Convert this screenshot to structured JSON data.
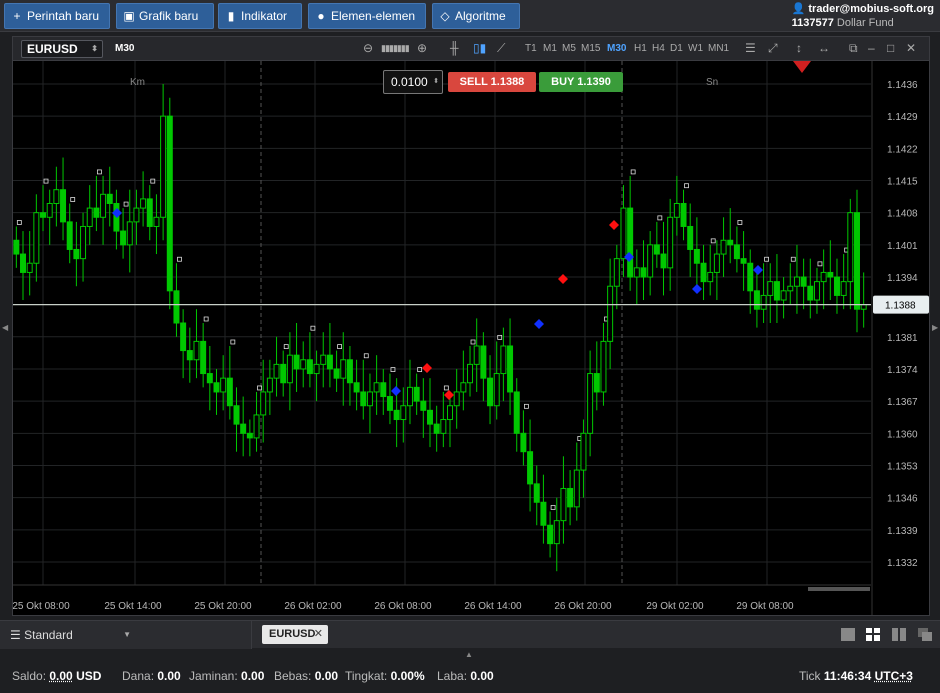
{
  "toolbar": {
    "buttons": [
      {
        "label": "Perintah baru",
        "icon": "plus-icon"
      },
      {
        "label": "Grafik baru",
        "icon": "chart-icon"
      },
      {
        "label": "Indikator",
        "icon": "bar-chart-icon"
      },
      {
        "label": "Elemen-elemen",
        "icon": "brush-icon"
      },
      {
        "label": "Algoritme",
        "icon": "diamond-icon"
      }
    ]
  },
  "account": {
    "user": "trader@mobius-soft.org",
    "number": "1137577",
    "fund": "Dollar Fund"
  },
  "chart": {
    "symbol": "EURUSD",
    "timeframe": "M30",
    "timeframes": [
      "T1",
      "M1",
      "M5",
      "M15",
      "M30",
      "H1",
      "H4",
      "D1",
      "W1",
      "MN1"
    ],
    "active_timeframe": "M30",
    "lot": "0.0100",
    "sell": {
      "label": "SELL",
      "price": "1.1388"
    },
    "buy": {
      "label": "BUY",
      "price": "1.1390"
    },
    "day_labels": [
      "Km",
      "Sn"
    ],
    "price_ticks": [
      "1.1436",
      "1.1429",
      "1.1422",
      "1.1415",
      "1.1408",
      "1.1401",
      "1.1394",
      "1.1381",
      "1.1374",
      "1.1367",
      "1.1360",
      "1.1353",
      "1.1346",
      "1.1339",
      "1.1332"
    ],
    "current_price": "1.1388",
    "time_ticks": [
      "25 Okt 08:00",
      "25 Okt 14:00",
      "25 Okt 20:00",
      "26 Okt 02:00",
      "26 Okt 08:00",
      "26 Okt 14:00",
      "26 Okt 20:00",
      "29 Okt 02:00",
      "29 Okt 08:00"
    ],
    "colors": {
      "up": "#00c800",
      "down": "#00a000",
      "bg": "#000000",
      "grid": "#222426",
      "price_line": "#c8d0c8"
    }
  },
  "chart_data": {
    "type": "candlestick",
    "title": "EURUSD M30",
    "y_axis_range": [
      1.1327,
      1.1441
    ],
    "current_price": 1.1388,
    "x_labels": [
      "25 Okt 08:00",
      "25 Okt 14:00",
      "25 Okt 20:00",
      "26 Okt 02:00",
      "26 Okt 08:00",
      "26 Okt 14:00",
      "26 Okt 20:00",
      "29 Okt 02:00",
      "29 Okt 08:00"
    ],
    "closes": [
      1.1399,
      1.1395,
      1.1397,
      1.1408,
      1.1407,
      1.141,
      1.1413,
      1.1406,
      1.14,
      1.1398,
      1.1405,
      1.1409,
      1.1407,
      1.1412,
      1.141,
      1.1404,
      1.1401,
      1.1406,
      1.1409,
      1.1411,
      1.1405,
      1.1407,
      1.1429,
      1.1391,
      1.1384,
      1.1378,
      1.1376,
      1.138,
      1.1373,
      1.1371,
      1.1369,
      1.1372,
      1.1366,
      1.1362,
      1.136,
      1.1359,
      1.1364,
      1.1369,
      1.1372,
      1.1375,
      1.1371,
      1.1377,
      1.1374,
      1.1376,
      1.1373,
      1.1375,
      1.1377,
      1.1374,
      1.1372,
      1.1376,
      1.1371,
      1.1369,
      1.1366,
      1.1369,
      1.1371,
      1.1368,
      1.1365,
      1.1363,
      1.1366,
      1.137,
      1.1367,
      1.1365,
      1.1362,
      1.136,
      1.1363,
      1.1366,
      1.1369,
      1.1371,
      1.1375,
      1.1379,
      1.1372,
      1.1366,
      1.1373,
      1.1379,
      1.1369,
      1.136,
      1.1356,
      1.1349,
      1.1345,
      1.134,
      1.1336,
      1.1341,
      1.1348,
      1.1344,
      1.1352,
      1.136,
      1.1373,
      1.1369,
      1.138,
      1.1392,
      1.1398,
      1.1409,
      1.1394,
      1.1396,
      1.1394,
      1.1401,
      1.1399,
      1.1396,
      1.1407,
      1.141,
      1.1405,
      1.14,
      1.1397,
      1.1393,
      1.1395,
      1.1399,
      1.1402,
      1.1401,
      1.1398,
      1.1397,
      1.1391,
      1.1387,
      1.139,
      1.1393,
      1.1389,
      1.1391,
      1.1392,
      1.1394,
      1.1392,
      1.1389,
      1.1393,
      1.1395,
      1.1394,
      1.139,
      1.1393,
      1.1408,
      1.1387,
      1.1388
    ]
  },
  "bottom": {
    "layout": "Standard",
    "tab": "EURUSD"
  },
  "status": {
    "saldo_label": "Saldo:",
    "saldo": "0.00",
    "currency": "USD",
    "dana_label": "Dana:",
    "dana": "0.00",
    "jaminan_label": "Jaminan:",
    "jaminan": "0.00",
    "bebas_label": "Bebas:",
    "bebas": "0.00",
    "tingkat_label": "Tingkat:",
    "tingkat": "0.00%",
    "laba_label": "Laba:",
    "laba": "0.00",
    "tick_label": "Tick",
    "time": "11:46:34",
    "tz": "UTC+3"
  }
}
